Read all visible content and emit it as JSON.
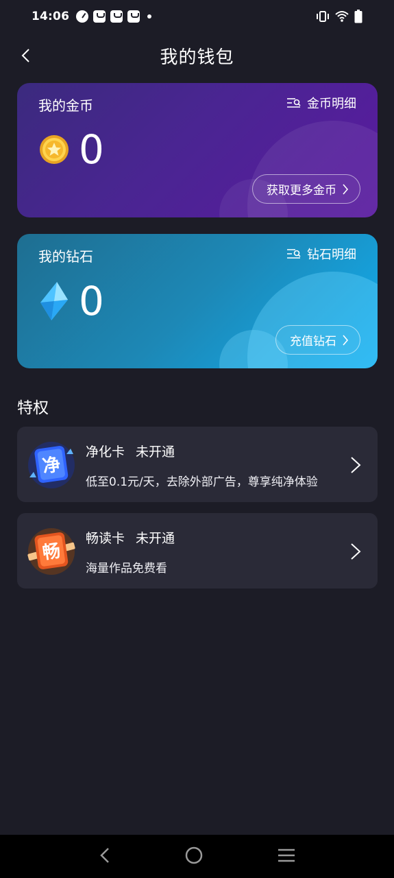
{
  "status": {
    "time": "14:06",
    "icons_left": [
      "speed-icon",
      "bag-icon",
      "bag-icon",
      "bag-icon",
      "dot-icon"
    ],
    "icons_right": [
      "vibrate-icon",
      "wifi-icon",
      "battery-icon"
    ]
  },
  "header": {
    "title": "我的钱包",
    "back_icon": "chevron-left-icon"
  },
  "gold_card": {
    "title": "我的金币",
    "detail_label": "金币明细",
    "balance": "0",
    "action_label": "获取更多金币",
    "colors": {
      "start": "#3b2a7e",
      "end": "#5a1aa0"
    }
  },
  "diamond_card": {
    "title": "我的钻石",
    "detail_label": "钻石明细",
    "balance": "0",
    "action_label": "充值钻石",
    "colors": {
      "start": "#1e6e91",
      "end": "#12aef0"
    }
  },
  "privileges": {
    "section_title": "特权",
    "items": [
      {
        "name": "净化卡",
        "status": "未开通",
        "desc": "低至0.1元/天，去除外部广告，尊享纯净体验",
        "icon_char": "净",
        "icon": "purify-card-icon"
      },
      {
        "name": "畅读卡",
        "status": "未开通",
        "desc": "海量作品免费看",
        "icon_char": "畅",
        "icon": "read-card-icon"
      }
    ]
  },
  "navbar": {
    "icons": [
      "nav-back-icon",
      "nav-home-icon",
      "nav-menu-icon"
    ]
  }
}
